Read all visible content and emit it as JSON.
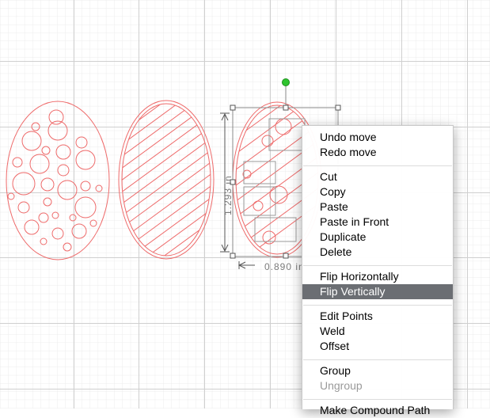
{
  "dimension": {
    "label": "0.890 in",
    "height_label": "1.293 in"
  },
  "context_menu": {
    "items": [
      {
        "label": "Undo move"
      },
      {
        "label": "Redo move"
      },
      {
        "label": "Cut"
      },
      {
        "label": "Copy"
      },
      {
        "label": "Paste"
      },
      {
        "label": "Paste in Front"
      },
      {
        "label": "Duplicate"
      },
      {
        "label": "Delete"
      },
      {
        "label": "Flip Horizontally"
      },
      {
        "label": "Flip Vertically",
        "highlighted": true
      },
      {
        "label": "Edit Points"
      },
      {
        "label": "Weld"
      },
      {
        "label": "Offset"
      },
      {
        "label": "Group"
      },
      {
        "label": "Ungroup",
        "disabled": true
      },
      {
        "label": "Make Compound Path"
      }
    ]
  },
  "colors": {
    "cut_line": "#ee6a6a",
    "grid_minor": "#ebebeb",
    "grid_major": "#cdcdcd",
    "rotate_handle": "#2fc42f",
    "highlight": "#6b6e73"
  }
}
